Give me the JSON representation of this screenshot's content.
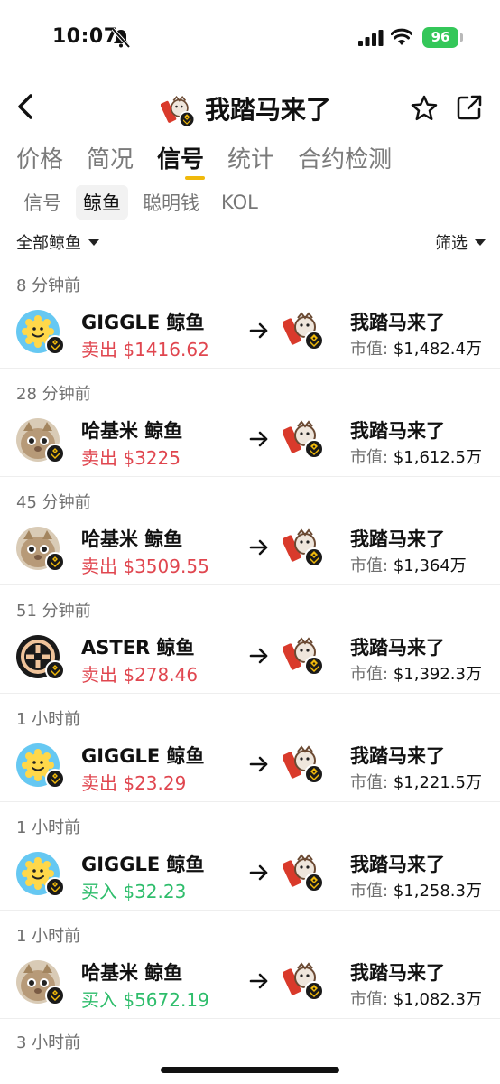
{
  "status_bar": {
    "time": "10:07",
    "battery": "96"
  },
  "header": {
    "title": "我踏马来了"
  },
  "tabs": [
    {
      "label": "价格"
    },
    {
      "label": "简况"
    },
    {
      "label": "信号"
    },
    {
      "label": "统计"
    },
    {
      "label": "合约检测"
    }
  ],
  "subtabs": [
    {
      "label": "信号"
    },
    {
      "label": "鲸鱼"
    },
    {
      "label": "聪明钱"
    },
    {
      "label": "KOL"
    }
  ],
  "filter": {
    "left": "全部鲸鱼",
    "right": "筛选"
  },
  "market_cap_label": "市值:",
  "items": [
    {
      "time": "8 分钟前",
      "whale": "GIGGLE 鲸鱼",
      "action": "卖出",
      "amount": "$1416.62",
      "side": "sell",
      "avatar": "giggle-icon",
      "token": "我踏马来了",
      "mcap": "$1,482.4万"
    },
    {
      "time": "28 分钟前",
      "whale": "哈基米 鲸鱼",
      "action": "卖出",
      "amount": "$3225",
      "side": "sell",
      "avatar": "hachimi-icon",
      "token": "我踏马来了",
      "mcap": "$1,612.5万"
    },
    {
      "time": "45 分钟前",
      "whale": "哈基米 鲸鱼",
      "action": "卖出",
      "amount": "$3509.55",
      "side": "sell",
      "avatar": "hachimi-icon",
      "token": "我踏马来了",
      "mcap": "$1,364万"
    },
    {
      "time": "51 分钟前",
      "whale": "ASTER 鲸鱼",
      "action": "卖出",
      "amount": "$278.46",
      "side": "sell",
      "avatar": "aster-icon",
      "token": "我踏马来了",
      "mcap": "$1,392.3万"
    },
    {
      "time": "1 小时前",
      "whale": "GIGGLE 鲸鱼",
      "action": "卖出",
      "amount": "$23.29",
      "side": "sell",
      "avatar": "giggle-icon",
      "token": "我踏马来了",
      "mcap": "$1,221.5万"
    },
    {
      "time": "1 小时前",
      "whale": "GIGGLE 鲸鱼",
      "action": "买入",
      "amount": "$32.23",
      "side": "buy",
      "avatar": "giggle-icon",
      "token": "我踏马来了",
      "mcap": "$1,258.3万"
    },
    {
      "time": "1 小时前",
      "whale": "哈基米 鲸鱼",
      "action": "买入",
      "amount": "$5672.19",
      "side": "buy",
      "avatar": "hachimi-icon",
      "token": "我踏马来了",
      "mcap": "$1,082.3万"
    }
  ],
  "partial_time": "3 小时前",
  "colors": {
    "accent": "#f0b90b",
    "sell": "#e0464f",
    "buy": "#2ebd6b",
    "battery": "#34c759"
  }
}
